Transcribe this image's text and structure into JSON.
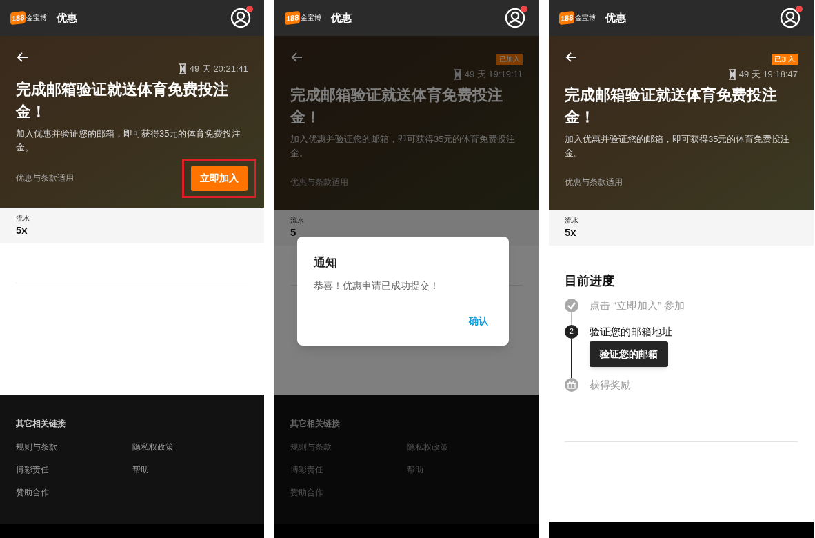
{
  "screens": [
    {
      "header": {
        "logo_number": "188",
        "logo_name": "金宝博",
        "title": "优惠",
        "notification_dot": true
      },
      "promo": {
        "timer": "49 天 20:21:41",
        "title": "完成邮箱验证就送体育免费投注金！",
        "description": "加入优惠并验证您的邮箱，即可获得35元的体育免费投注金。",
        "terms": "优惠与条款适用",
        "join_button": {
          "label": "立即加入",
          "highlighted": true
        }
      },
      "stats": {
        "label": "流水",
        "value": "5x"
      },
      "footer": {
        "title": "其它相关链接",
        "links": [
          "规则与条款",
          "隐私权政策",
          "博彩责任",
          "帮助",
          "赞助合作"
        ]
      }
    },
    {
      "header": {
        "logo_number": "188",
        "logo_name": "金宝博",
        "title": "优惠",
        "notification_dot": true
      },
      "promo": {
        "badge": "已加入",
        "timer": "49 天 19:19:11",
        "title": "完成邮箱验证就送体育免费投注金！",
        "description": "加入优惠并验证您的邮箱，即可获得35元的体育免费投注金。",
        "terms": "优惠与条款适用"
      },
      "stats": {
        "label": "流水",
        "value": "5"
      },
      "footer": {
        "title": "其它相关链接",
        "links": [
          "规则与条款",
          "隐私权政策",
          "博彩责任",
          "帮助",
          "赞助合作"
        ]
      },
      "dialog": {
        "title": "通知",
        "message": "恭喜！优惠申请已成功提交！",
        "button": "确认"
      }
    },
    {
      "header": {
        "logo_number": "188",
        "logo_name": "金宝博",
        "title": "优惠",
        "notification_dot": true
      },
      "promo": {
        "badge": "已加入",
        "timer": "49 天 19:18:47",
        "title": "完成邮箱验证就送体育免费投注金！",
        "description": "加入优惠并验证您的邮箱，即可获得35元的体育免费投注金。",
        "terms": "优惠与条款适用"
      },
      "stats": {
        "label": "流水",
        "value": "5x"
      },
      "progress": {
        "title": "目前进度",
        "steps": [
          {
            "kind": "done",
            "label": "点击 “立即加入” 参加"
          },
          {
            "kind": "current",
            "number": "2",
            "label": "验证您的邮箱地址",
            "action": "验证您的邮箱"
          },
          {
            "kind": "pending",
            "label": "获得奖励"
          }
        ]
      }
    }
  ]
}
